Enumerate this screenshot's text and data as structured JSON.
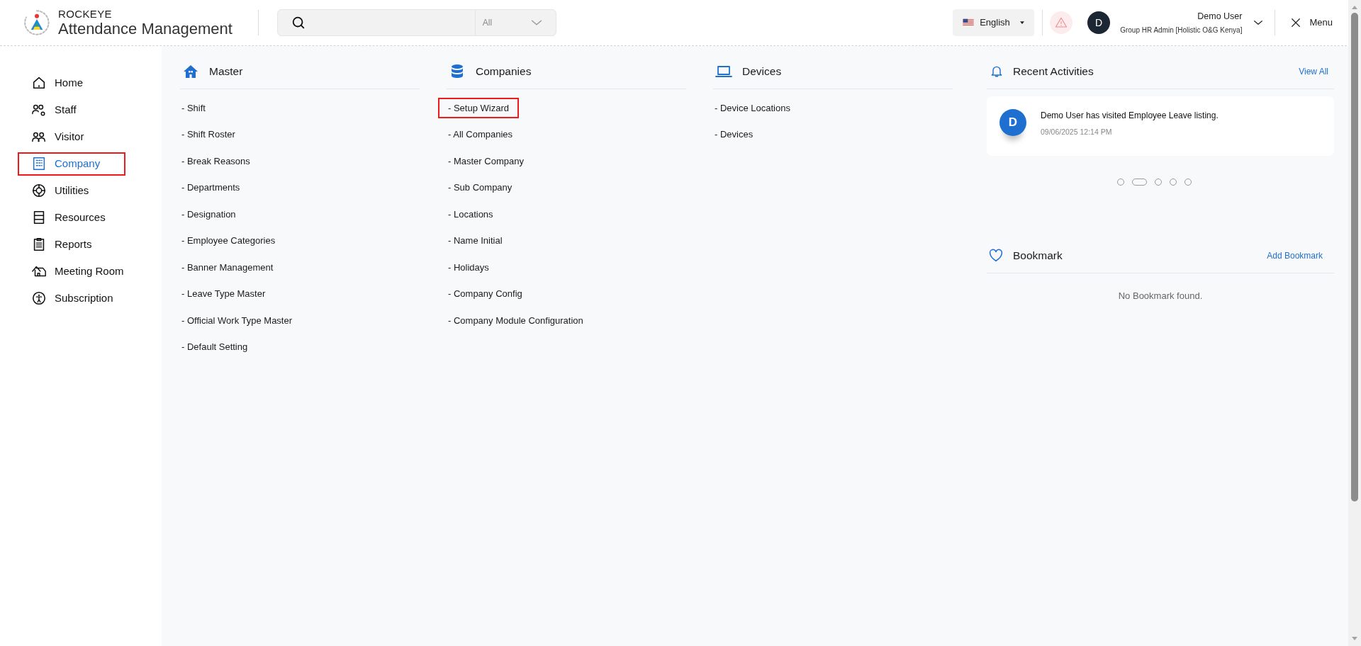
{
  "header": {
    "brand_top": "ROCKEYE",
    "brand_title": "Attendance Management",
    "search": {
      "scope": "All"
    },
    "language": "English",
    "user": {
      "initial": "D",
      "name": "Demo User",
      "role": "Group HR Admin [Holistic O&G Kenya]"
    },
    "menu_label": "Menu"
  },
  "sidebar": {
    "items": [
      {
        "label": "Home",
        "selected": false,
        "highlighted": false
      },
      {
        "label": "Staff",
        "selected": false,
        "highlighted": false
      },
      {
        "label": "Visitor",
        "selected": false,
        "highlighted": false
      },
      {
        "label": "Company",
        "selected": true,
        "highlighted": true
      },
      {
        "label": "Utilities",
        "selected": false,
        "highlighted": false
      },
      {
        "label": "Resources",
        "selected": false,
        "highlighted": false
      },
      {
        "label": "Reports",
        "selected": false,
        "highlighted": false
      },
      {
        "label": "Meeting Room",
        "selected": false,
        "highlighted": false
      },
      {
        "label": "Subscription",
        "selected": false,
        "highlighted": false
      }
    ]
  },
  "sections": [
    {
      "title": "Master",
      "items": [
        {
          "label": "- Shift",
          "highlighted": false
        },
        {
          "label": "- Shift Roster",
          "highlighted": false
        },
        {
          "label": "- Break Reasons",
          "highlighted": false
        },
        {
          "label": "- Departments",
          "highlighted": false
        },
        {
          "label": "- Designation",
          "highlighted": false
        },
        {
          "label": "- Employee Categories",
          "highlighted": false
        },
        {
          "label": "- Banner Management",
          "highlighted": false
        },
        {
          "label": "- Leave Type Master",
          "highlighted": false
        },
        {
          "label": "- Official Work Type Master",
          "highlighted": false
        },
        {
          "label": "- Default Setting",
          "highlighted": false
        }
      ]
    },
    {
      "title": "Companies",
      "items": [
        {
          "label": "- Setup Wizard",
          "highlighted": true
        },
        {
          "label": "- All Companies",
          "highlighted": false
        },
        {
          "label": "- Master Company",
          "highlighted": false
        },
        {
          "label": "- Sub Company",
          "highlighted": false
        },
        {
          "label": "- Locations",
          "highlighted": false
        },
        {
          "label": "- Name Initial",
          "highlighted": false
        },
        {
          "label": "- Holidays",
          "highlighted": false
        },
        {
          "label": "- Company Config",
          "highlighted": false
        },
        {
          "label": "- Company Module Configuration",
          "highlighted": false
        }
      ]
    },
    {
      "title": "Devices",
      "items": [
        {
          "label": "- Device Locations",
          "highlighted": false
        },
        {
          "label": "- Devices",
          "highlighted": false
        }
      ]
    }
  ],
  "recent_activities": {
    "title": "Recent Activities",
    "link": "View All",
    "activities": [
      {
        "initial": "D",
        "text": "Demo User has visited Employee Leave listing.",
        "time": "09/06/2025 12:14 PM"
      }
    ],
    "pages": [
      {
        "selected": false
      },
      {
        "selected": true
      },
      {
        "selected": false
      },
      {
        "selected": false
      },
      {
        "selected": false
      }
    ]
  },
  "bookmark": {
    "title": "Bookmark",
    "link": "Add Bookmark",
    "empty_text": "No Bookmark found."
  }
}
